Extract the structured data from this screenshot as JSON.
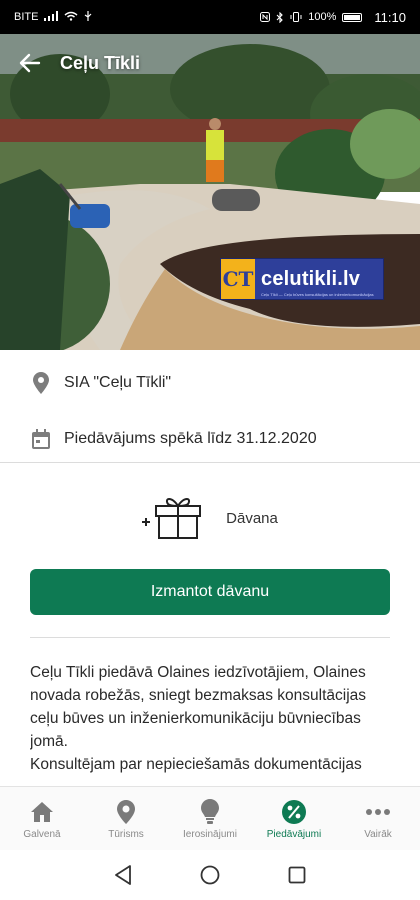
{
  "status_bar": {
    "carrier": "BITE",
    "battery": "100%",
    "time": "11:10"
  },
  "app_bar": {
    "title": "Ceļu Tīkli"
  },
  "hero": {
    "logo_mark": "CT",
    "logo_text": "celutikli.lv",
    "logo_sub": "Ceļu Tīkli — Ceļu būves konsultācijas un inženierkomunikācijas",
    "accent": "#2e3f9a"
  },
  "info": {
    "company": "SIA \"Ceļu Tīkli\"",
    "validity": "Piedāvājums spēkā līdz 31.12.2020"
  },
  "gift": {
    "label": "Dāvana"
  },
  "action": {
    "use_label": "Izmantot dāvanu",
    "color": "#0e7a53"
  },
  "description": {
    "paragraphs": [
      "Ceļu Tīkli piedāvā Olaines iedzīvotājiem, Olaines novada robežās, sniegt bezmaksas konsultācijas ceļu būves un inženierkomunikāciju būvniecības jomā.",
      "Konsultējam par nepieciešamās dokumentācijas"
    ]
  },
  "bottom_nav": {
    "items": [
      {
        "label": "Galvenā",
        "icon": "home-icon"
      },
      {
        "label": "Tūrisms",
        "icon": "location-pin-icon"
      },
      {
        "label": "Ierosinājumi",
        "icon": "lightbulb-icon"
      },
      {
        "label": "Piedāvājumi",
        "icon": "percent-badge-icon"
      },
      {
        "label": "Vairāk",
        "icon": "more-dots-icon"
      }
    ],
    "active_color": "#0e7a53"
  }
}
